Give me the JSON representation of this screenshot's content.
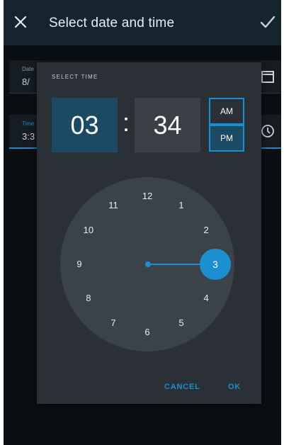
{
  "app_bar": {
    "title": "Select date and time",
    "close_icon": "close-icon",
    "confirm_icon": "check-icon"
  },
  "form": {
    "date": {
      "label": "Date",
      "value": "8/",
      "icon": "calendar-icon"
    },
    "time": {
      "label": "Time",
      "value": "3:3",
      "icon": "clock-icon"
    }
  },
  "dialog": {
    "title": "SELECT TIME",
    "hour": "03",
    "separator": ":",
    "minute": "34",
    "am_label": "AM",
    "pm_label": "PM",
    "selected_period": "PM",
    "clock_numbers": [
      "12",
      "1",
      "2",
      "3",
      "4",
      "5",
      "6",
      "7",
      "8",
      "9",
      "10",
      "11"
    ],
    "selected_hour": "3",
    "cancel_label": "CANCEL",
    "ok_label": "OK"
  },
  "colors": {
    "accent": "#1a90d0",
    "selected_box": "#1b4a64",
    "dialog_bg": "#2a3036",
    "clock_face": "#3b434a"
  }
}
